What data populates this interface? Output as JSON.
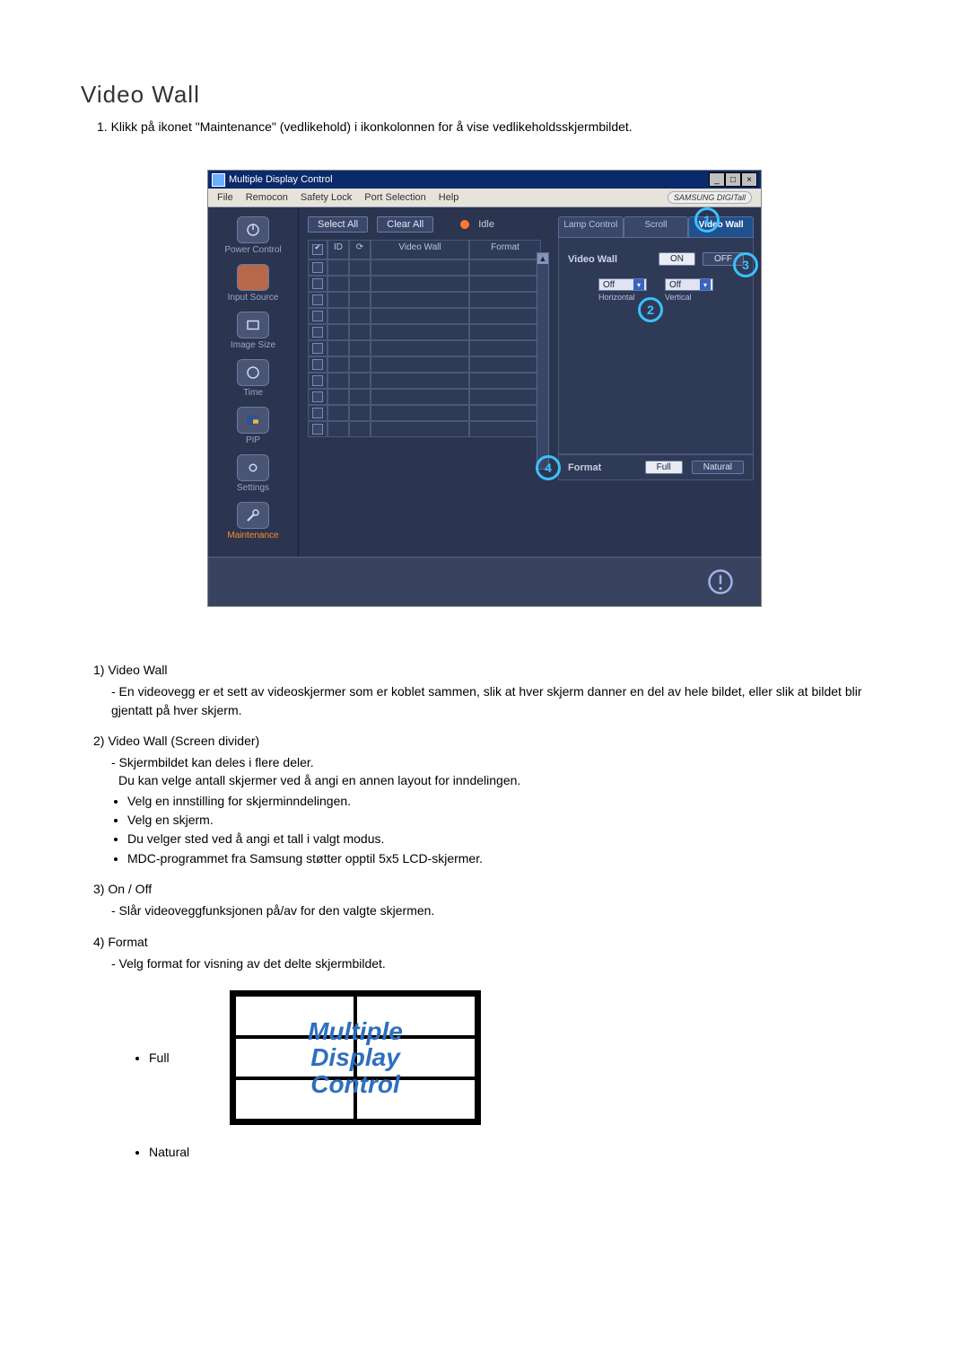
{
  "page": {
    "title": "Video Wall",
    "intro": "1. Klikk på ikonet \"Maintenance\" (vedlikehold) i ikonkolonnen for å vise vedlikeholdsskjermbildet."
  },
  "app": {
    "window_title": "Multiple Display Control",
    "menu": [
      "File",
      "Remocon",
      "Safety Lock",
      "Port Selection",
      "Help"
    ],
    "brand": "SAMSUNG DIGITall",
    "toolbar": {
      "select_all": "Select All",
      "clear_all": "Clear All",
      "idle": "Idle"
    },
    "sidebar": [
      {
        "label": "Power Control"
      },
      {
        "label": "Input Source"
      },
      {
        "label": "Image Size"
      },
      {
        "label": "Time"
      },
      {
        "label": "PIP"
      },
      {
        "label": "Settings"
      },
      {
        "label": "Maintenance",
        "active": true
      }
    ],
    "grid": {
      "cols": [
        "",
        "ID",
        "",
        "Video Wall",
        "Format"
      ],
      "first_row_checked": true,
      "row_count": 11
    },
    "tabs": {
      "lamp": "Lamp Control",
      "scroll": "Scroll",
      "videowall": "Video Wall"
    },
    "panel": {
      "vw_label": "Video Wall",
      "on": "ON",
      "off": "OFF",
      "h_value": "Off",
      "v_value": "Off",
      "h_caption": "Horizontal",
      "v_caption": "Vertical"
    },
    "format": {
      "label": "Format",
      "full": "Full",
      "natural": "Natural"
    },
    "badges": {
      "b1": "1",
      "b2": "2",
      "b3": "3",
      "b4": "4"
    }
  },
  "explain": {
    "i1_title": "1) Video Wall",
    "i1_dash": "- En videovegg er et sett av videoskjermer som er koblet sammen, slik at hver skjerm danner en del av hele bildet, eller slik at bildet blir gjentatt på hver skjerm.",
    "i2_title": "2) Video Wall (Screen divider)",
    "i2_dash1": "- Skjermbildet kan deles i flere deler.",
    "i2_dash2": "Du kan velge antall skjermer ved å angi en annen layout for inndelingen.",
    "i2_b1": "Velg en innstilling for skjerminndelingen.",
    "i2_b2": "Velg en skjerm.",
    "i2_b3": "Du velger sted ved å angi et tall i valgt modus.",
    "i2_b4": "MDC-programmet fra Samsung støtter opptil 5x5 LCD-skjermer.",
    "i3_title": "3) On / Off",
    "i3_dash": "- Slår videoveggfunksjonen på/av for den valgte skjermen.",
    "i4_title": "4) Format",
    "i4_dash": "- Velg format for visning av det delte skjermbildet.",
    "full": "Full",
    "natural": "Natural",
    "mdc_l1": "Multiple",
    "mdc_l2": "Display",
    "mdc_l3": "Control"
  }
}
